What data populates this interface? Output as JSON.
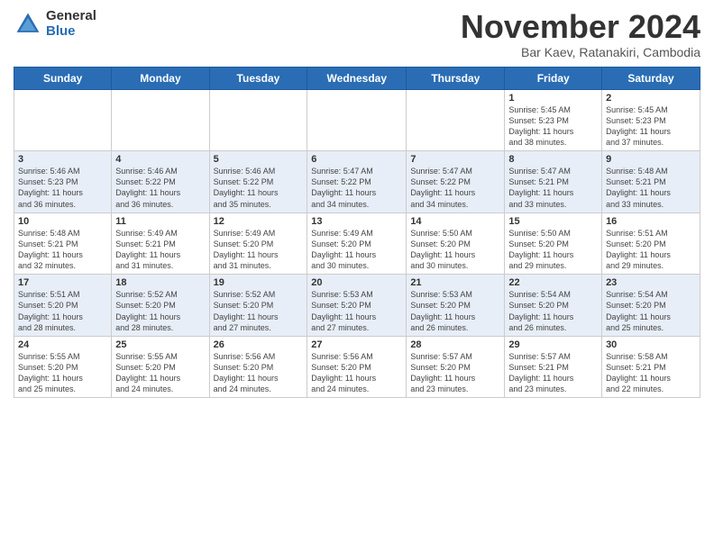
{
  "logo": {
    "general": "General",
    "blue": "Blue"
  },
  "title": "November 2024",
  "location": "Bar Kaev, Ratanakiri, Cambodia",
  "days_of_week": [
    "Sunday",
    "Monday",
    "Tuesday",
    "Wednesday",
    "Thursday",
    "Friday",
    "Saturday"
  ],
  "weeks": [
    [
      {
        "day": "",
        "info": ""
      },
      {
        "day": "",
        "info": ""
      },
      {
        "day": "",
        "info": ""
      },
      {
        "day": "",
        "info": ""
      },
      {
        "day": "",
        "info": ""
      },
      {
        "day": "1",
        "info": "Sunrise: 5:45 AM\nSunset: 5:23 PM\nDaylight: 11 hours\nand 38 minutes."
      },
      {
        "day": "2",
        "info": "Sunrise: 5:45 AM\nSunset: 5:23 PM\nDaylight: 11 hours\nand 37 minutes."
      }
    ],
    [
      {
        "day": "3",
        "info": "Sunrise: 5:46 AM\nSunset: 5:23 PM\nDaylight: 11 hours\nand 36 minutes."
      },
      {
        "day": "4",
        "info": "Sunrise: 5:46 AM\nSunset: 5:22 PM\nDaylight: 11 hours\nand 36 minutes."
      },
      {
        "day": "5",
        "info": "Sunrise: 5:46 AM\nSunset: 5:22 PM\nDaylight: 11 hours\nand 35 minutes."
      },
      {
        "day": "6",
        "info": "Sunrise: 5:47 AM\nSunset: 5:22 PM\nDaylight: 11 hours\nand 34 minutes."
      },
      {
        "day": "7",
        "info": "Sunrise: 5:47 AM\nSunset: 5:22 PM\nDaylight: 11 hours\nand 34 minutes."
      },
      {
        "day": "8",
        "info": "Sunrise: 5:47 AM\nSunset: 5:21 PM\nDaylight: 11 hours\nand 33 minutes."
      },
      {
        "day": "9",
        "info": "Sunrise: 5:48 AM\nSunset: 5:21 PM\nDaylight: 11 hours\nand 33 minutes."
      }
    ],
    [
      {
        "day": "10",
        "info": "Sunrise: 5:48 AM\nSunset: 5:21 PM\nDaylight: 11 hours\nand 32 minutes."
      },
      {
        "day": "11",
        "info": "Sunrise: 5:49 AM\nSunset: 5:21 PM\nDaylight: 11 hours\nand 31 minutes."
      },
      {
        "day": "12",
        "info": "Sunrise: 5:49 AM\nSunset: 5:20 PM\nDaylight: 11 hours\nand 31 minutes."
      },
      {
        "day": "13",
        "info": "Sunrise: 5:49 AM\nSunset: 5:20 PM\nDaylight: 11 hours\nand 30 minutes."
      },
      {
        "day": "14",
        "info": "Sunrise: 5:50 AM\nSunset: 5:20 PM\nDaylight: 11 hours\nand 30 minutes."
      },
      {
        "day": "15",
        "info": "Sunrise: 5:50 AM\nSunset: 5:20 PM\nDaylight: 11 hours\nand 29 minutes."
      },
      {
        "day": "16",
        "info": "Sunrise: 5:51 AM\nSunset: 5:20 PM\nDaylight: 11 hours\nand 29 minutes."
      }
    ],
    [
      {
        "day": "17",
        "info": "Sunrise: 5:51 AM\nSunset: 5:20 PM\nDaylight: 11 hours\nand 28 minutes."
      },
      {
        "day": "18",
        "info": "Sunrise: 5:52 AM\nSunset: 5:20 PM\nDaylight: 11 hours\nand 28 minutes."
      },
      {
        "day": "19",
        "info": "Sunrise: 5:52 AM\nSunset: 5:20 PM\nDaylight: 11 hours\nand 27 minutes."
      },
      {
        "day": "20",
        "info": "Sunrise: 5:53 AM\nSunset: 5:20 PM\nDaylight: 11 hours\nand 27 minutes."
      },
      {
        "day": "21",
        "info": "Sunrise: 5:53 AM\nSunset: 5:20 PM\nDaylight: 11 hours\nand 26 minutes."
      },
      {
        "day": "22",
        "info": "Sunrise: 5:54 AM\nSunset: 5:20 PM\nDaylight: 11 hours\nand 26 minutes."
      },
      {
        "day": "23",
        "info": "Sunrise: 5:54 AM\nSunset: 5:20 PM\nDaylight: 11 hours\nand 25 minutes."
      }
    ],
    [
      {
        "day": "24",
        "info": "Sunrise: 5:55 AM\nSunset: 5:20 PM\nDaylight: 11 hours\nand 25 minutes."
      },
      {
        "day": "25",
        "info": "Sunrise: 5:55 AM\nSunset: 5:20 PM\nDaylight: 11 hours\nand 24 minutes."
      },
      {
        "day": "26",
        "info": "Sunrise: 5:56 AM\nSunset: 5:20 PM\nDaylight: 11 hours\nand 24 minutes."
      },
      {
        "day": "27",
        "info": "Sunrise: 5:56 AM\nSunset: 5:20 PM\nDaylight: 11 hours\nand 24 minutes."
      },
      {
        "day": "28",
        "info": "Sunrise: 5:57 AM\nSunset: 5:20 PM\nDaylight: 11 hours\nand 23 minutes."
      },
      {
        "day": "29",
        "info": "Sunrise: 5:57 AM\nSunset: 5:21 PM\nDaylight: 11 hours\nand 23 minutes."
      },
      {
        "day": "30",
        "info": "Sunrise: 5:58 AM\nSunset: 5:21 PM\nDaylight: 11 hours\nand 22 minutes."
      }
    ]
  ]
}
